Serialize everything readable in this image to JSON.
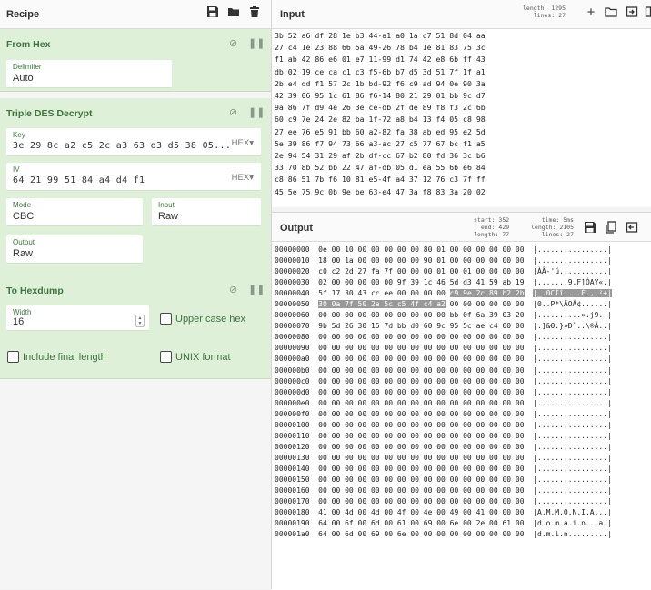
{
  "recipe": {
    "title": "Recipe",
    "operations": [
      {
        "name": "From Hex",
        "fields": {
          "delimiter_label": "Delimiter",
          "delimiter_value": "Auto"
        }
      },
      {
        "name": "Triple DES Decrypt",
        "fields": {
          "key_label": "Key",
          "key_value": "3e 29 8c a2 c5 2c a3 63 d3 d5 38 05...",
          "key_format": "HEX",
          "iv_label": "IV",
          "iv_value": "64 21 99 51 84 a4 d4 f1",
          "iv_format": "HEX",
          "mode_label": "Mode",
          "mode_value": "CBC",
          "input_label": "Input",
          "input_value": "Raw",
          "output_label": "Output",
          "output_value": "Raw"
        }
      },
      {
        "name": "To Hexdump",
        "fields": {
          "width_label": "Width",
          "width_value": "16",
          "uppercase_label": "Upper case hex",
          "final_length_label": "Include final length",
          "unix_label": "UNIX format"
        }
      }
    ]
  },
  "input": {
    "title": "Input",
    "stats": {
      "length_label": "length:",
      "length": "1295",
      "lines_label": "lines:",
      "lines": "27"
    },
    "lines": [
      "3b 52 a6 df 28 1e b3 44-a1 a0 1a c7 51 8d 04 aa",
      "27 c4 1e 23 88 66 5a 49-26 78 b4 1e 81 83 75 3c",
      "f1 ab 42 86 e6 01 e7 11-99 d1 74 42 e8 6b ff 43",
      "db 02 19 ce ca c1 c3 f5-6b b7 d5 3d 51 7f 1f a1",
      "2b e4 dd f1 57 2c 1b bd-92 f6 c9 ad 94 0e 90 3a",
      "42 39 06 95 1c 61 86 f6-14 80 21 29 01 bb 9c d7",
      "9a 86 7f d9 4e 26 3e ce-db 2f de 89 f8 f3 2c 6b",
      "60 c9 7e 24 2e 82 ba 1f-72 a8 b4 13 f4 05 c8 98",
      "27 ee 76 e5 91 bb 60 a2-82 fa 38 ab ed 95 e2 5d",
      "5e 39 86 f7 94 73 66 a3-ac 27 c5 77 67 bc f1 a5",
      "2e 94 54 31 29 af 2b df-cc 67 b2 80 fd 36 3c b6",
      "33 70 8b 52 bb 22 47 af-db 05 d1 ea 55 6b e6 84",
      "c8 86 51 7b f6 10 81 e5-4f a4 37 12 76 c3 7f ff",
      "45 5e 75 9c 0b 9e be 63-e4 47 3a f8 83 3a 20 02"
    ]
  },
  "output": {
    "title": "Output",
    "stats": {
      "start_label": "start:",
      "start": "352",
      "end_label": "end:",
      "end": "429",
      "length_label": "length:",
      "length": "77",
      "time_label": "time:",
      "time": "5ms",
      "length2_label": "length:",
      "length2": "2105",
      "lines_label": "lines:",
      "lines": "27"
    },
    "rows": [
      {
        "off": "00000000",
        "hex": "0e 00 10 00 00 00 00 00 80 01 00 00 00 00 00 00",
        "asc": "|................|"
      },
      {
        "off": "00000010",
        "hex": "18 00 1a 00 00 00 00 00 90 01 00 00 00 00 00 00",
        "asc": "|................|"
      },
      {
        "off": "00000020",
        "hex": "c0 c2 2d 27 fa 7f 00 00 00 01 00 01 00 00 00 00",
        "asc": "|ÀÂ-'ú...........|"
      },
      {
        "off": "00000030",
        "hex": "02 00 00 00 00 00 9f 39 1c 46 5d d3 41 59 ab 19",
        "asc": "|.......9.F]ÓAY«.|"
      },
      {
        "off": "00000040",
        "hex_a": "5f 17 30 43 cc ee 00 00 00 00 ",
        "hex_b": "c9 9e 2c 89 b2 2b",
        "asc_b": "|_.0CÌî....É.,.²+|"
      },
      {
        "off": "00000050",
        "hex_a": "30 0a 7f 50 2a 5c c5 4f c4 a2",
        "hex_c": " 00 00 00 00 00 00",
        "asc": "|0..P*\\ÅOÄ¢......|"
      },
      {
        "off": "00000060",
        "hex": "00 00 00 00 00 00 00 00 00 00 bb 0f 6a 39 03 20",
        "asc": "|..........».j9. |"
      },
      {
        "off": "00000070",
        "hex": "9b 5d 26 30 15 7d bb d0 60 9c 95 5c ae c4 00 00",
        "asc": "|.]&0.}»Ð`..\\®Ä..|"
      },
      {
        "off": "00000080",
        "hex": "00 00 00 00 00 00 00 00 00 00 00 00 00 00 00 00",
        "asc": "|................|"
      },
      {
        "off": "00000090",
        "hex": "00 00 00 00 00 00 00 00 00 00 00 00 00 00 00 00",
        "asc": "|................|"
      },
      {
        "off": "000000a0",
        "hex": "00 00 00 00 00 00 00 00 00 00 00 00 00 00 00 00",
        "asc": "|................|"
      },
      {
        "off": "000000b0",
        "hex": "00 00 00 00 00 00 00 00 00 00 00 00 00 00 00 00",
        "asc": "|................|"
      },
      {
        "off": "000000c0",
        "hex": "00 00 00 00 00 00 00 00 00 00 00 00 00 00 00 00",
        "asc": "|................|"
      },
      {
        "off": "000000d0",
        "hex": "00 00 00 00 00 00 00 00 00 00 00 00 00 00 00 00",
        "asc": "|................|"
      },
      {
        "off": "000000e0",
        "hex": "00 00 00 00 00 00 00 00 00 00 00 00 00 00 00 00",
        "asc": "|................|"
      },
      {
        "off": "000000f0",
        "hex": "00 00 00 00 00 00 00 00 00 00 00 00 00 00 00 00",
        "asc": "|................|"
      },
      {
        "off": "00000100",
        "hex": "00 00 00 00 00 00 00 00 00 00 00 00 00 00 00 00",
        "asc": "|................|"
      },
      {
        "off": "00000110",
        "hex": "00 00 00 00 00 00 00 00 00 00 00 00 00 00 00 00",
        "asc": "|................|"
      },
      {
        "off": "00000120",
        "hex": "00 00 00 00 00 00 00 00 00 00 00 00 00 00 00 00",
        "asc": "|................|"
      },
      {
        "off": "00000130",
        "hex": "00 00 00 00 00 00 00 00 00 00 00 00 00 00 00 00",
        "asc": "|................|"
      },
      {
        "off": "00000140",
        "hex": "00 00 00 00 00 00 00 00 00 00 00 00 00 00 00 00",
        "asc": "|................|"
      },
      {
        "off": "00000150",
        "hex": "00 00 00 00 00 00 00 00 00 00 00 00 00 00 00 00",
        "asc": "|................|"
      },
      {
        "off": "00000160",
        "hex": "00 00 00 00 00 00 00 00 00 00 00 00 00 00 00 00",
        "asc": "|................|"
      },
      {
        "off": "00000170",
        "hex": "00 00 00 00 00 00 00 00 00 00 00 00 00 00 00 00",
        "asc": "|................|"
      },
      {
        "off": "00000180",
        "hex": "41 00 4d 00 4d 00 4f 00 4e 00 49 00 41 00 00 00",
        "asc": "|A.M.M.O.N.I.A...|"
      },
      {
        "off": "00000190",
        "hex": "64 00 6f 00 6d 00 61 00 69 00 6e 00 2e 00 61 00",
        "asc": "|d.o.m.a.i.n...a.|"
      },
      {
        "off": "000001a0",
        "hex": "64 00 6d 00 69 00 6e 00 00 00 00 00 00 00 00 00",
        "asc": "|d.m.i.n.........|"
      }
    ]
  }
}
